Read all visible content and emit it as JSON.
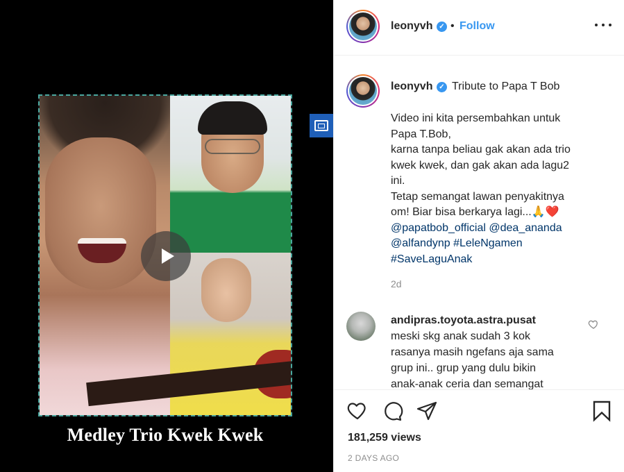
{
  "media": {
    "video_title": "Medley Trio Kwek Kwek"
  },
  "header": {
    "username": "leonyvh",
    "dot": "•",
    "follow_label": "Follow"
  },
  "caption": {
    "username": "leonyvh",
    "first_line": "Tribute to Papa T Bob",
    "lines": [
      "Video ini kita persembahkan untuk",
      "Papa T.Bob,",
      "karna tanpa beliau gak akan ada trio",
      "kwek kwek, dan gak akan ada lagu2",
      "ini.",
      "Tetap semangat lawan penyakitnya",
      "om! Biar bisa berkarya lagi...🙏❤️"
    ],
    "tags_line_1": "@papatbob_official @dea_ananda",
    "tags_line_2": "@alfandynp #LeleNgamen",
    "tags_line_3": "#SaveLaguAnak",
    "time": "2d"
  },
  "comment": {
    "username": "andipras.toyota.astra.pusat",
    "lines": [
      "meski skg anak sudah 3 kok",
      "rasanya masih ngefans aja sama",
      "grup ini.. grup yang dulu bikin",
      "anak-anak ceria dan semangat"
    ]
  },
  "stats": {
    "views_count": "181,259",
    "views_label": "views",
    "date": "2 DAYS AGO"
  },
  "colors": {
    "accent": "#3897f0",
    "text": "#262626",
    "muted": "#8e8e8e",
    "link": "#003569",
    "pip": "#1f5fb8"
  },
  "icons": [
    "play-icon",
    "pip-icon",
    "verified-icon",
    "more-icon",
    "heart-icon",
    "comment-icon",
    "share-icon",
    "bookmark-icon"
  ]
}
